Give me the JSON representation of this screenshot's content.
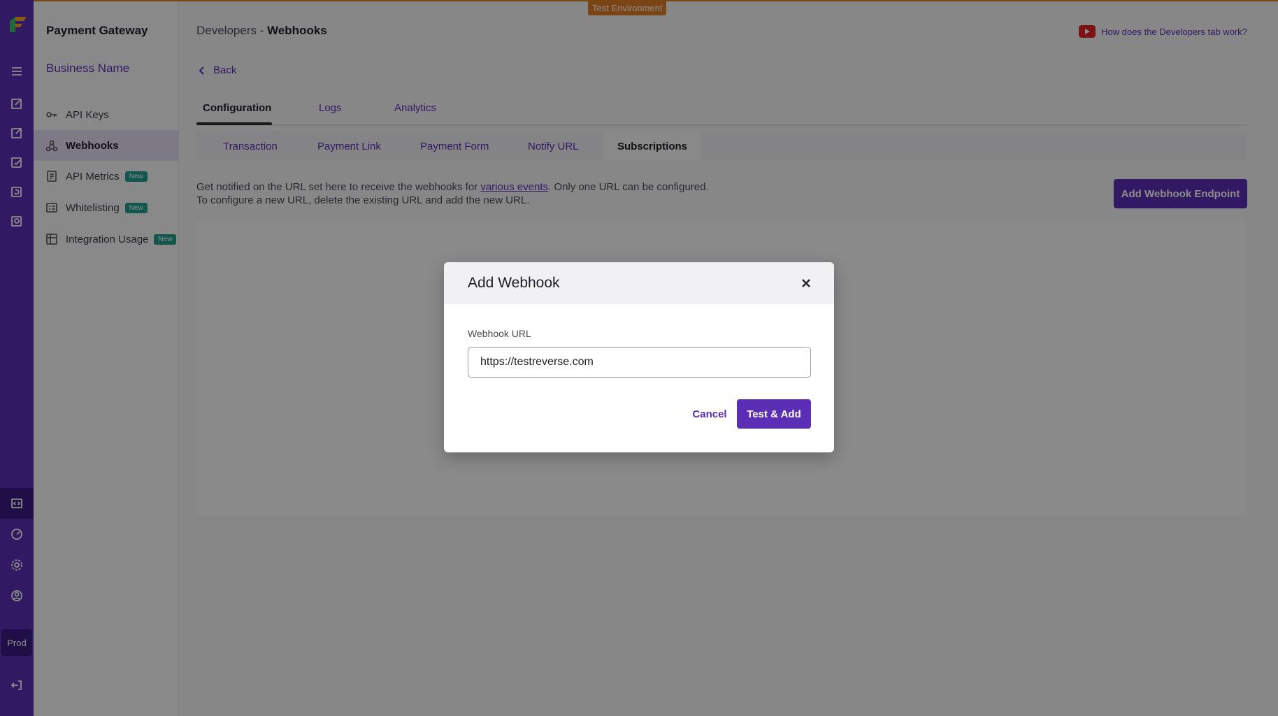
{
  "env_label": "Test Environment",
  "rail": {
    "prod_label": "Prod"
  },
  "sidebar": {
    "title": "Payment Gateway",
    "business": "Business Name",
    "items": [
      {
        "label": "API Keys",
        "icon": "key-icon",
        "badge": ""
      },
      {
        "label": "Webhooks",
        "icon": "webhook-icon",
        "badge": ""
      },
      {
        "label": "API Metrics",
        "icon": "document-icon",
        "badge": "New"
      },
      {
        "label": "Whitelisting",
        "icon": "list-icon",
        "badge": "New"
      },
      {
        "label": "Integration Usage",
        "icon": "grid-icon",
        "badge": "New"
      }
    ]
  },
  "header": {
    "breadcrumb_parent": "Developers -",
    "breadcrumb_current": "Webhooks",
    "help_link": "How does the Developers tab work?",
    "back": "Back"
  },
  "tabs": [
    "Configuration",
    "Logs",
    "Analytics"
  ],
  "subtabs": [
    "Transaction",
    "Payment Link",
    "Payment Form",
    "Notify URL",
    "Subscriptions"
  ],
  "description": {
    "line1_a": "Get notified on the URL set here to receive the webhooks for ",
    "line1_link": "various events",
    "line1_b": ". Only one URL can be configured.",
    "line2": "To configure a new URL, delete the existing URL and add the new URL."
  },
  "add_button": "Add Webhook Endpoint",
  "modal": {
    "title": "Add Webhook",
    "field_label": "Webhook URL",
    "field_value": "https://testreverse.com",
    "cancel": "Cancel",
    "submit": "Test & Add"
  },
  "colors": {
    "accent": "#5b2fb5",
    "env": "#e07d27",
    "badge": "#1f9e8c"
  }
}
